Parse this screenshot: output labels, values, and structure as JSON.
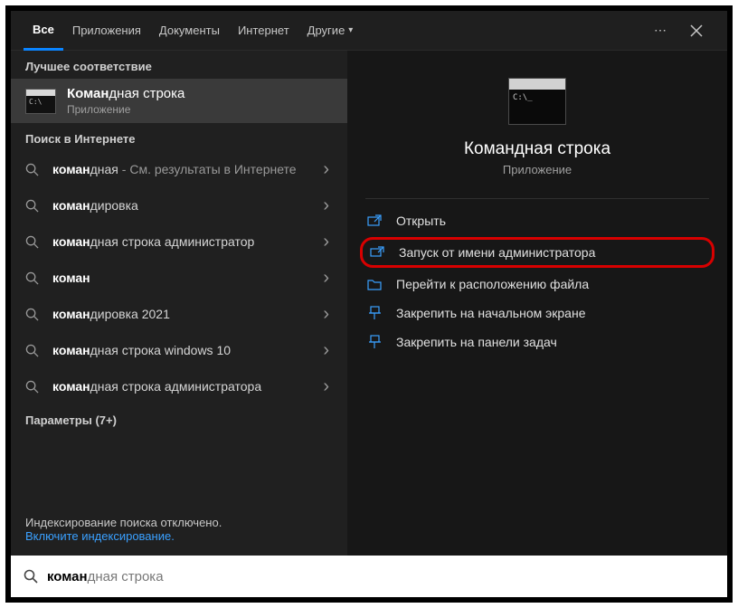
{
  "tabs": {
    "all": "Все",
    "apps": "Приложения",
    "docs": "Документы",
    "web": "Интернет",
    "other": "Другие"
  },
  "sections": {
    "best_match": "Лучшее соответствие",
    "web_search": "Поиск в Интернете",
    "settings": "Параметры (7+)"
  },
  "best_match": {
    "title_bold": "Коман",
    "title_rest": "дная строка",
    "subtitle": "Приложение"
  },
  "web_results": [
    {
      "bold": "коман",
      "rest": "дная",
      "extra": " - См. результаты в Интернете"
    },
    {
      "bold": "коман",
      "rest": "дировка",
      "extra": ""
    },
    {
      "bold": "коман",
      "rest": "дная строка администратор",
      "extra": ""
    },
    {
      "bold": "коман",
      "rest": "",
      "extra": ""
    },
    {
      "bold": "коман",
      "rest": "дировка 2021",
      "extra": ""
    },
    {
      "bold": "коман",
      "rest": "дная строка windows 10",
      "extra": ""
    },
    {
      "bold": "коман",
      "rest": "дная строка администратора",
      "extra": ""
    }
  ],
  "indexing": {
    "line1": "Индексирование поиска отключено.",
    "line2": "Включите индексирование."
  },
  "preview": {
    "title": "Командная строка",
    "subtitle": "Приложение",
    "actions": {
      "open": "Открыть",
      "run_admin": "Запуск от имени администратора",
      "open_location": "Перейти к расположению файла",
      "pin_start": "Закрепить на начальном экране",
      "pin_taskbar": "Закрепить на панели задач"
    }
  },
  "search": {
    "bold": "коман",
    "rest": "дная строка",
    "placeholder": ""
  }
}
